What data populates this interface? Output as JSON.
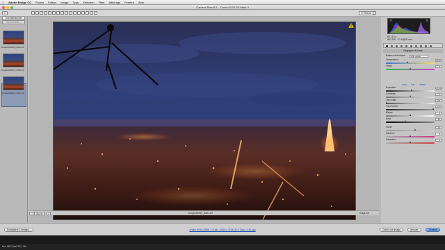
{
  "menubar": {
    "app": "Adobe Bridge CC",
    "items": [
      "Fichier",
      "Edition",
      "Image",
      "Type",
      "Sélection",
      "Filtre",
      "Affichage",
      "Fenêtre",
      "Aide"
    ],
    "clock": "Ven. 27 juin 14:36"
  },
  "window": {
    "title": "Camera Raw 8.5 – Canon EOS 5D Mark II"
  },
  "toolbar": {
    "filmstrip_toggle": "≡",
    "preview_label": "Rétroc."
  },
  "filmstrip": {
    "select_all_label": "Tout sélectionner",
    "synchronize_label": "Synchroniser...",
    "thumbnails": [
      {
        "label": "Dropbox/Eiffel_NuitA.cr2"
      },
      {
        "label": "Dropbox/Eiffel_NuitB.cr2"
      },
      {
        "label": "Dropbox/Eiffel_NuitC.cr2"
      }
    ]
  },
  "statusbar": {
    "zoom": "35.3%",
    "image_counter": "Image 3/3",
    "filename": "Dropbox/Eiffel_NuitC.cr2"
  },
  "readout": {
    "aperture": "f/8",
    "shutter": "8.0 s",
    "iso": "ISO 200",
    "focal": "17-40@20 mm",
    "rgb": "R: ---  V: ---  B: ---"
  },
  "basic_panel": {
    "title": "Réglages de base",
    "white_balance_label": "Balance des blancs",
    "white_balance_value": "Telle quelle",
    "temperature_label": "Température",
    "temperature_value": "4150",
    "tint_label": "Teinte",
    "tint_value": "0",
    "auto_label": "Auto",
    "default_label": "Par défaut",
    "exposure_label": "Exposition",
    "exposure_value": "+0,10",
    "contrast_label": "Contraste",
    "contrast_value": "0",
    "highlights_label": "Tons clairs",
    "highlights_value": "-100",
    "shadows_label": "Tons foncés",
    "shadows_value": "+100",
    "whites_label": "Blancs",
    "whites_value": "0",
    "blacks_label": "Noirs",
    "blacks_value": "-20",
    "clarity_label": "Clarté",
    "clarity_value": "+20",
    "vibrance_label": "Vibrance",
    "vibrance_value": "0",
    "saturation_label": "Saturation",
    "saturation_value": "0"
  },
  "bottombar": {
    "save_label": "Enregistrer 3 images...",
    "workflow_link": "Adobe RGB (1998) ; 16 bits ; 5616 x 3744 (21,0 Mpx) ; 240 ppp",
    "open_label": "Ouvrir une image",
    "cancel_label": "Annuler",
    "done_label": "Terminer"
  },
  "dock": {
    "status": "Ecr. 58,2 Mo/175,7 Mo"
  },
  "colors": {
    "primary_button": "#5d8fd6",
    "link": "#1c4fb4",
    "warning": "#f2c20f",
    "sky": "#2a3a6c"
  }
}
